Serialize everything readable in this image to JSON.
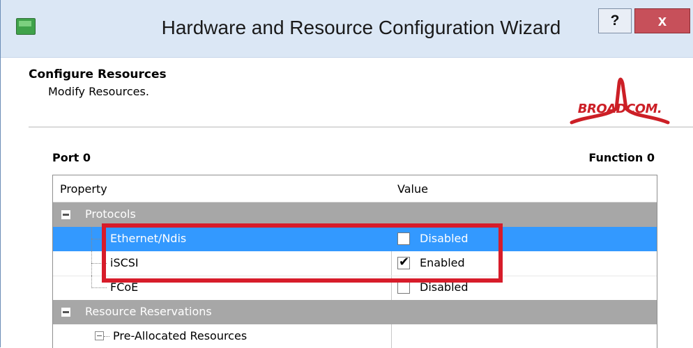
{
  "window": {
    "title": "Hardware and Resource Configuration Wizard",
    "help_label": "?",
    "close_label": "x"
  },
  "header": {
    "title": "Configure Resources",
    "subtitle": "Modify Resources.",
    "logo_text": "BROADCOM."
  },
  "section": {
    "port_label": "Port 0",
    "function_label": "Function 0"
  },
  "grid": {
    "columns": [
      "Property",
      "Value"
    ],
    "rows": [
      {
        "type": "group",
        "label": "Protocols"
      },
      {
        "type": "item",
        "label": "Ethernet/Ndis",
        "value": "Disabled",
        "checked": false,
        "selected": true
      },
      {
        "type": "item",
        "label": "iSCSI",
        "value": "Enabled",
        "checked": true,
        "selected": false
      },
      {
        "type": "item",
        "label": "FCoE",
        "value": "Disabled",
        "checked": false,
        "selected": false
      },
      {
        "type": "group",
        "label": "Resource Reservations"
      },
      {
        "type": "item",
        "label": "Pre-Allocated Resources",
        "value": "",
        "expandable": true
      }
    ]
  },
  "colors": {
    "selection": "#3399ff",
    "group_row": "#a7a7a7",
    "highlight_box": "#d71c2a",
    "brand": "#cc1f26"
  }
}
